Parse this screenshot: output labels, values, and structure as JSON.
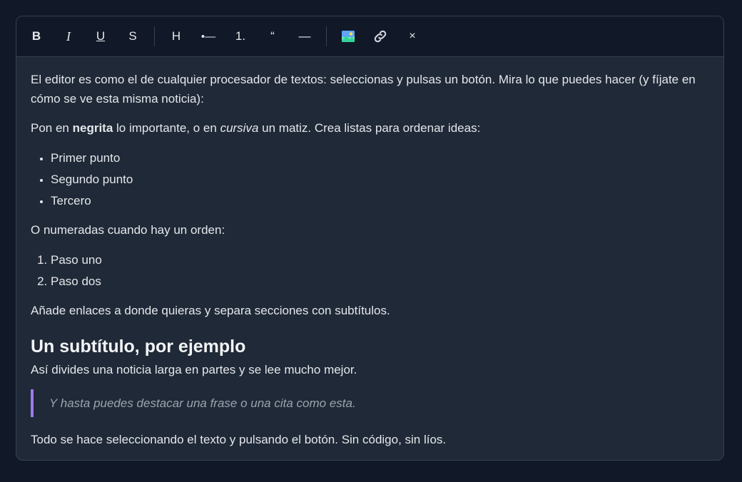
{
  "toolbar": {
    "bold_label": "B",
    "italic_label": "I",
    "underline_label": "U",
    "strike_label": "S",
    "heading_label": "H",
    "bullet_list_label": "•—",
    "ordered_list_label": "1.",
    "quote_label": "“",
    "hr_label": "—",
    "image_icon": "image-icon",
    "link_icon": "link-icon",
    "clear_label": "×"
  },
  "content": {
    "intro": "El editor es como el de cualquier procesador de textos: seleccionas y pulsas un botón. Mira lo que puedes hacer (y fíjate en cómo se ve esta misma noticia):",
    "format_pre": "Pon en ",
    "format_bold": "negrita",
    "format_mid": " lo importante, o en ",
    "format_italic": "cursiva",
    "format_post": " un matiz. Crea listas para ordenar ideas:",
    "bullets": [
      "Primer punto",
      "Segundo punto",
      "Tercero"
    ],
    "numbered_intro": "O numeradas cuando hay un orden:",
    "numbered": [
      "Paso uno",
      "Paso dos"
    ],
    "links_text": "Añade enlaces a donde quieras y separa secciones con subtítulos.",
    "subtitle": "Un subtítulo, por ejemplo",
    "subtitle_text": "Así divides una noticia larga en partes y se lee mucho mejor.",
    "quote": "Y hasta puedes destacar una frase o una cita como esta.",
    "closing": "Todo se hace seleccionando el texto y pulsando el botón. Sin código, sin líos."
  },
  "colors": {
    "page_bg": "#111827",
    "editor_bg": "#1f2937",
    "toolbar_bg": "#111827",
    "border": "#374151",
    "text": "#e5e7eb",
    "quote_bar": "#9f7aea",
    "quote_text": "#9ca3af"
  }
}
